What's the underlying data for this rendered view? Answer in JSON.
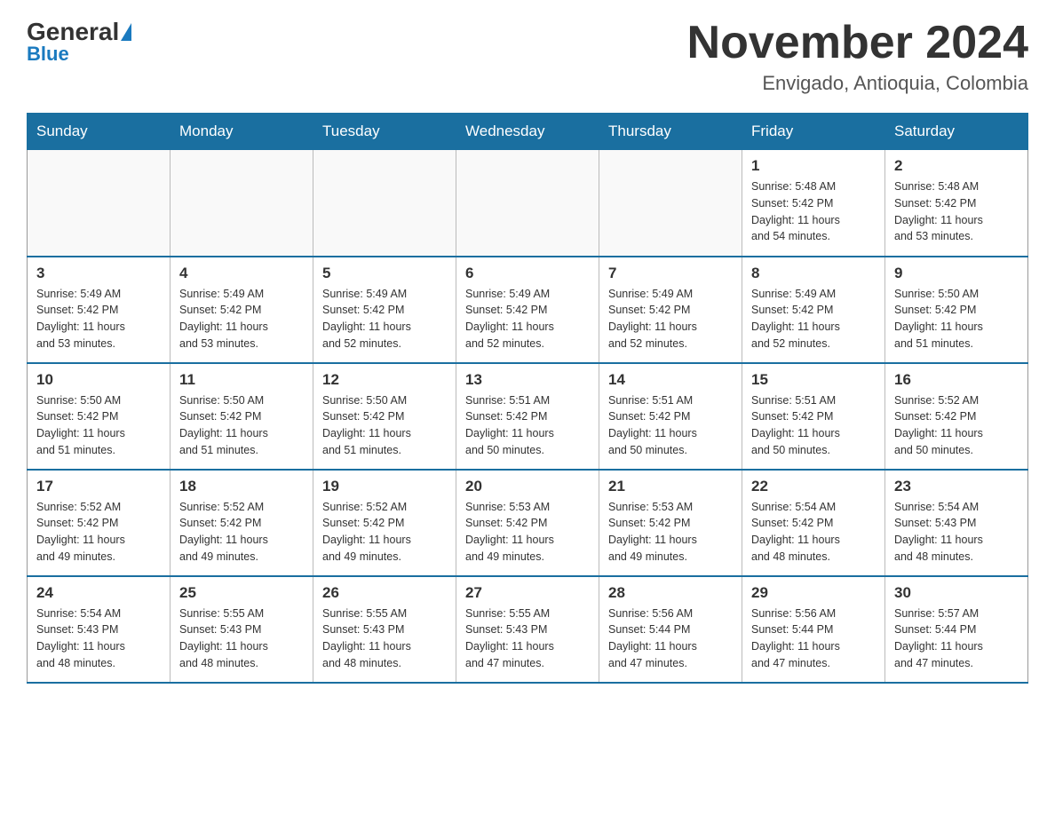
{
  "header": {
    "logo_general": "General",
    "logo_blue": "Blue",
    "title": "November 2024",
    "subtitle": "Envigado, Antioquia, Colombia"
  },
  "days_of_week": [
    "Sunday",
    "Monday",
    "Tuesday",
    "Wednesday",
    "Thursday",
    "Friday",
    "Saturday"
  ],
  "weeks": [
    [
      {
        "day": "",
        "info": ""
      },
      {
        "day": "",
        "info": ""
      },
      {
        "day": "",
        "info": ""
      },
      {
        "day": "",
        "info": ""
      },
      {
        "day": "",
        "info": ""
      },
      {
        "day": "1",
        "info": "Sunrise: 5:48 AM\nSunset: 5:42 PM\nDaylight: 11 hours\nand 54 minutes."
      },
      {
        "day": "2",
        "info": "Sunrise: 5:48 AM\nSunset: 5:42 PM\nDaylight: 11 hours\nand 53 minutes."
      }
    ],
    [
      {
        "day": "3",
        "info": "Sunrise: 5:49 AM\nSunset: 5:42 PM\nDaylight: 11 hours\nand 53 minutes."
      },
      {
        "day": "4",
        "info": "Sunrise: 5:49 AM\nSunset: 5:42 PM\nDaylight: 11 hours\nand 53 minutes."
      },
      {
        "day": "5",
        "info": "Sunrise: 5:49 AM\nSunset: 5:42 PM\nDaylight: 11 hours\nand 52 minutes."
      },
      {
        "day": "6",
        "info": "Sunrise: 5:49 AM\nSunset: 5:42 PM\nDaylight: 11 hours\nand 52 minutes."
      },
      {
        "day": "7",
        "info": "Sunrise: 5:49 AM\nSunset: 5:42 PM\nDaylight: 11 hours\nand 52 minutes."
      },
      {
        "day": "8",
        "info": "Sunrise: 5:49 AM\nSunset: 5:42 PM\nDaylight: 11 hours\nand 52 minutes."
      },
      {
        "day": "9",
        "info": "Sunrise: 5:50 AM\nSunset: 5:42 PM\nDaylight: 11 hours\nand 51 minutes."
      }
    ],
    [
      {
        "day": "10",
        "info": "Sunrise: 5:50 AM\nSunset: 5:42 PM\nDaylight: 11 hours\nand 51 minutes."
      },
      {
        "day": "11",
        "info": "Sunrise: 5:50 AM\nSunset: 5:42 PM\nDaylight: 11 hours\nand 51 minutes."
      },
      {
        "day": "12",
        "info": "Sunrise: 5:50 AM\nSunset: 5:42 PM\nDaylight: 11 hours\nand 51 minutes."
      },
      {
        "day": "13",
        "info": "Sunrise: 5:51 AM\nSunset: 5:42 PM\nDaylight: 11 hours\nand 50 minutes."
      },
      {
        "day": "14",
        "info": "Sunrise: 5:51 AM\nSunset: 5:42 PM\nDaylight: 11 hours\nand 50 minutes."
      },
      {
        "day": "15",
        "info": "Sunrise: 5:51 AM\nSunset: 5:42 PM\nDaylight: 11 hours\nand 50 minutes."
      },
      {
        "day": "16",
        "info": "Sunrise: 5:52 AM\nSunset: 5:42 PM\nDaylight: 11 hours\nand 50 minutes."
      }
    ],
    [
      {
        "day": "17",
        "info": "Sunrise: 5:52 AM\nSunset: 5:42 PM\nDaylight: 11 hours\nand 49 minutes."
      },
      {
        "day": "18",
        "info": "Sunrise: 5:52 AM\nSunset: 5:42 PM\nDaylight: 11 hours\nand 49 minutes."
      },
      {
        "day": "19",
        "info": "Sunrise: 5:52 AM\nSunset: 5:42 PM\nDaylight: 11 hours\nand 49 minutes."
      },
      {
        "day": "20",
        "info": "Sunrise: 5:53 AM\nSunset: 5:42 PM\nDaylight: 11 hours\nand 49 minutes."
      },
      {
        "day": "21",
        "info": "Sunrise: 5:53 AM\nSunset: 5:42 PM\nDaylight: 11 hours\nand 49 minutes."
      },
      {
        "day": "22",
        "info": "Sunrise: 5:54 AM\nSunset: 5:42 PM\nDaylight: 11 hours\nand 48 minutes."
      },
      {
        "day": "23",
        "info": "Sunrise: 5:54 AM\nSunset: 5:43 PM\nDaylight: 11 hours\nand 48 minutes."
      }
    ],
    [
      {
        "day": "24",
        "info": "Sunrise: 5:54 AM\nSunset: 5:43 PM\nDaylight: 11 hours\nand 48 minutes."
      },
      {
        "day": "25",
        "info": "Sunrise: 5:55 AM\nSunset: 5:43 PM\nDaylight: 11 hours\nand 48 minutes."
      },
      {
        "day": "26",
        "info": "Sunrise: 5:55 AM\nSunset: 5:43 PM\nDaylight: 11 hours\nand 48 minutes."
      },
      {
        "day": "27",
        "info": "Sunrise: 5:55 AM\nSunset: 5:43 PM\nDaylight: 11 hours\nand 47 minutes."
      },
      {
        "day": "28",
        "info": "Sunrise: 5:56 AM\nSunset: 5:44 PM\nDaylight: 11 hours\nand 47 minutes."
      },
      {
        "day": "29",
        "info": "Sunrise: 5:56 AM\nSunset: 5:44 PM\nDaylight: 11 hours\nand 47 minutes."
      },
      {
        "day": "30",
        "info": "Sunrise: 5:57 AM\nSunset: 5:44 PM\nDaylight: 11 hours\nand 47 minutes."
      }
    ]
  ]
}
